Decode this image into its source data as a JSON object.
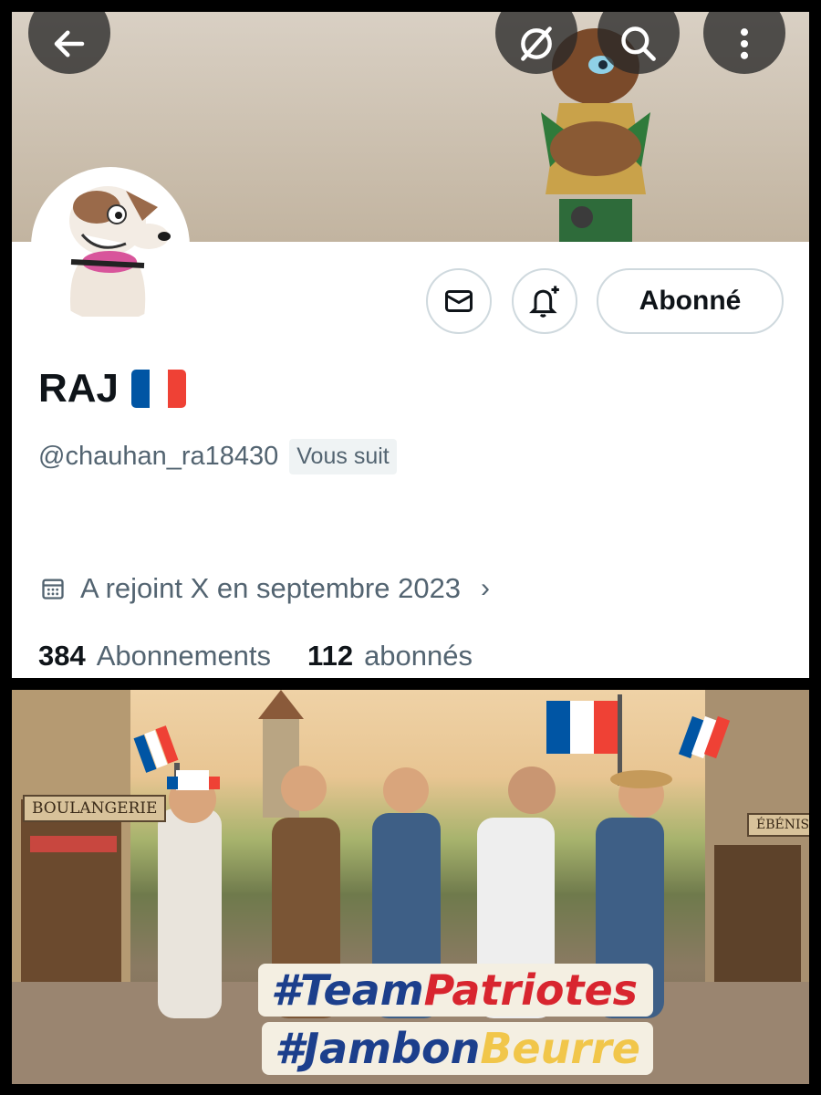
{
  "profile": {
    "name": "RAJ",
    "handle": "@chauhan_ra18430",
    "follows_you": "Vous suit",
    "joined": "A rejoint X en septembre 2023",
    "following_count": "384",
    "following_label": "Abonnements",
    "followers_count": "112",
    "followers_label": "abonnés"
  },
  "actions": {
    "follow_label": "Abonné"
  },
  "banner_image": {
    "signs": [
      "BOULANGERIE",
      "ÉBÉNISTE"
    ],
    "hashtag1_part1": "#Team",
    "hashtag1_part2": "Patriotes",
    "hashtag2_part1": "#Jambon",
    "hashtag2_part2": "Beurre"
  },
  "colors": {
    "flag_blue": "#0055a4",
    "flag_white": "#ffffff",
    "flag_red": "#ef4135",
    "text_primary": "#0f1419",
    "text_secondary": "#536471"
  },
  "icons": [
    "back-arrow-icon",
    "hide-icon",
    "search-icon",
    "more-icon",
    "mail-icon",
    "bell-plus-icon",
    "calendar-icon",
    "chevron-right-icon"
  ]
}
